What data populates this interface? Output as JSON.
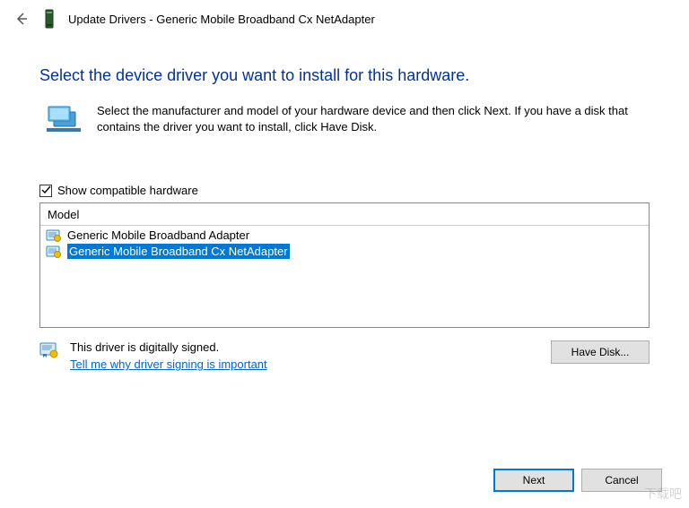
{
  "title": "Update Drivers - Generic Mobile Broadband Cx NetAdapter",
  "heading": "Select the device driver you want to install for this hardware.",
  "instruction": "Select the manufacturer and model of your hardware device and then click Next. If you have a disk that contains the driver you want to install, click Have Disk.",
  "compat": {
    "checked": true,
    "label": "Show compatible hardware"
  },
  "model": {
    "header": "Model",
    "items": [
      {
        "label": "Generic Mobile Broadband Adapter",
        "selected": false
      },
      {
        "label": "Generic Mobile Broadband Cx NetAdapter",
        "selected": true
      }
    ]
  },
  "signed": {
    "status": "This driver is digitally signed.",
    "link": "Tell me why driver signing is important"
  },
  "buttons": {
    "have_disk": "Have Disk...",
    "next": "Next",
    "cancel": "Cancel"
  },
  "watermark": "下载吧"
}
